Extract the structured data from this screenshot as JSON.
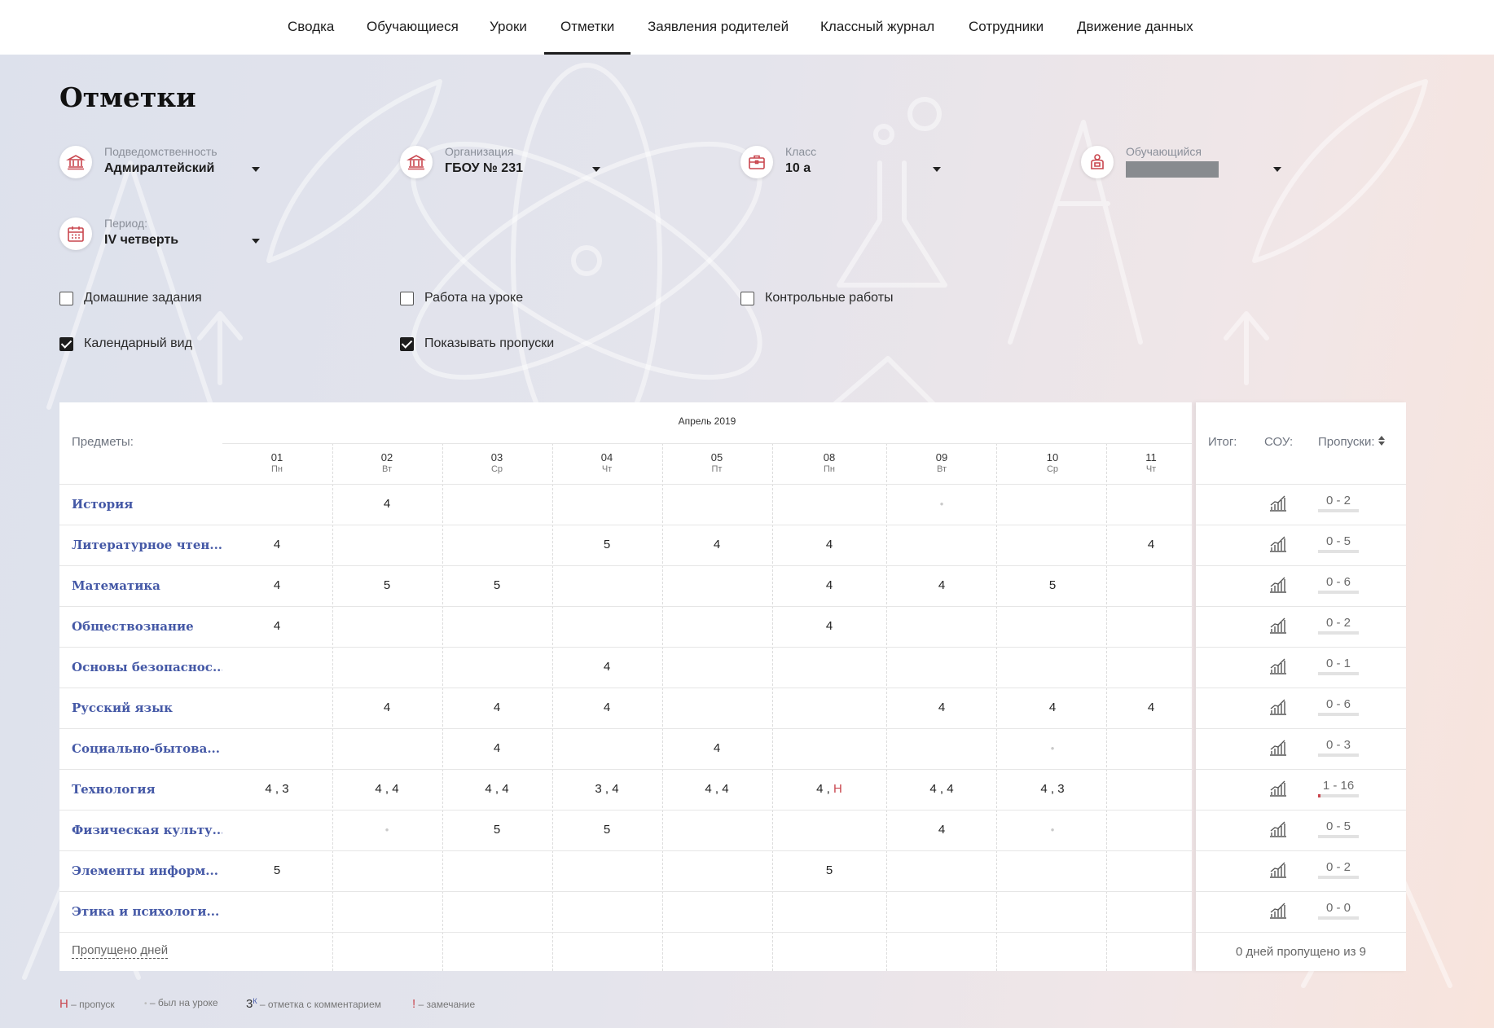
{
  "nav": {
    "items": [
      "Сводка",
      "Обучающиеся",
      "Уроки",
      "Отметки",
      "Заявления родителей",
      "Классный журнал",
      "Сотрудники",
      "Движение данных"
    ],
    "active": "Отметки"
  },
  "page_title": "Отметки",
  "filters": {
    "subordination": {
      "label": "Подведомственность",
      "value": "Адмиралтейский"
    },
    "organization": {
      "label": "Организация",
      "value": "ГБОУ № 231"
    },
    "class": {
      "label": "Класс",
      "value": "10 а"
    },
    "student": {
      "label": "Обучающийся",
      "value": ""
    },
    "period": {
      "label": "Период:",
      "value": "IV четверть"
    }
  },
  "checkboxes": [
    {
      "label": "Домашние задания",
      "checked": false
    },
    {
      "label": "Работа на уроке",
      "checked": false
    },
    {
      "label": "Контрольные работы",
      "checked": false
    },
    {
      "label": "Календарный вид",
      "checked": true
    },
    {
      "label": "Показывать пропуски",
      "checked": true
    }
  ],
  "table": {
    "subjects_header": "Предметы:",
    "month": "Апрель 2019",
    "days": [
      {
        "d": "01",
        "w": "Пн"
      },
      {
        "d": "02",
        "w": "Вт"
      },
      {
        "d": "03",
        "w": "Ср"
      },
      {
        "d": "04",
        "w": "Чт"
      },
      {
        "d": "05",
        "w": "Пт"
      },
      {
        "d": "08",
        "w": "Пн"
      },
      {
        "d": "09",
        "w": "Вт"
      },
      {
        "d": "10",
        "w": "Ср"
      },
      {
        "d": "11",
        "w": "Чт"
      }
    ],
    "rows": [
      {
        "subject": "История",
        "cells": [
          "",
          "4",
          "",
          "",
          "",
          "",
          "•",
          "",
          ""
        ],
        "absences": "0 - 2",
        "abs_frac": 0
      },
      {
        "subject": "Литературное чтен...",
        "cells": [
          "4",
          "",
          "",
          "5",
          "4",
          "4",
          "",
          "",
          "4"
        ],
        "absences": "0 - 5",
        "abs_frac": 0
      },
      {
        "subject": "Математика",
        "cells": [
          "4",
          "5",
          "5",
          "",
          "",
          "4",
          "4",
          "5",
          ""
        ],
        "absences": "0 - 6",
        "abs_frac": 0
      },
      {
        "subject": "Обществознание",
        "cells": [
          "4",
          "",
          "",
          "",
          "",
          "4",
          "",
          "",
          ""
        ],
        "absences": "0 - 2",
        "abs_frac": 0
      },
      {
        "subject": "Основы безопаснос...",
        "cells": [
          "",
          "",
          "",
          "4",
          "",
          "",
          "",
          "",
          ""
        ],
        "absences": "0 - 1",
        "abs_frac": 0
      },
      {
        "subject": "Русский язык",
        "cells": [
          "",
          "4",
          "4",
          "4",
          "",
          "",
          "4",
          "4",
          "4"
        ],
        "absences": "0 - 6",
        "abs_frac": 0
      },
      {
        "subject": "Социально-бытова...",
        "cells": [
          "",
          "",
          "4",
          "",
          "4",
          "",
          "",
          "•",
          ""
        ],
        "absences": "0 - 3",
        "abs_frac": 0
      },
      {
        "subject": "Технология",
        "cells": [
          "4 , 3",
          "4 , 4",
          "4 , 4",
          "3 , 4",
          "4 , 4",
          "4 , Н",
          "4 , 4",
          "4 , 3",
          ""
        ],
        "absences": "1 - 16",
        "abs_frac": 0.0625
      },
      {
        "subject": "Физическая культу...",
        "cells": [
          "",
          "•",
          "5",
          "5",
          "",
          "",
          "4",
          "•",
          ""
        ],
        "absences": "0 - 5",
        "abs_frac": 0
      },
      {
        "subject": "Элементы информ...",
        "cells": [
          "5",
          "",
          "",
          "",
          "",
          "5",
          "",
          "",
          ""
        ],
        "absences": "0 - 2",
        "abs_frac": 0
      },
      {
        "subject": "Этика и психологи...",
        "cells": [
          "",
          "",
          "",
          "",
          "",
          "",
          "",
          "",
          ""
        ],
        "absences": "0 - 0",
        "abs_frac": 0
      }
    ],
    "missed_days_label": "Пропущено дней",
    "summary": {
      "total_header": "Итог:",
      "sou_header": "СОУ:",
      "absences_header": "Пропуски:",
      "footer": "0 дней пропущено из 9"
    }
  },
  "legend": [
    {
      "mark": "Н",
      "text": " – пропуск"
    },
    {
      "mark": "•",
      "text": " – был на уроке"
    },
    {
      "mark": "3",
      "sup": "К",
      "text": " – отметка с комментарием"
    },
    {
      "mark": "!",
      "text": " – замечание"
    }
  ],
  "colors": {
    "accent": "#c9464e",
    "subject_link": "#4458a6"
  }
}
